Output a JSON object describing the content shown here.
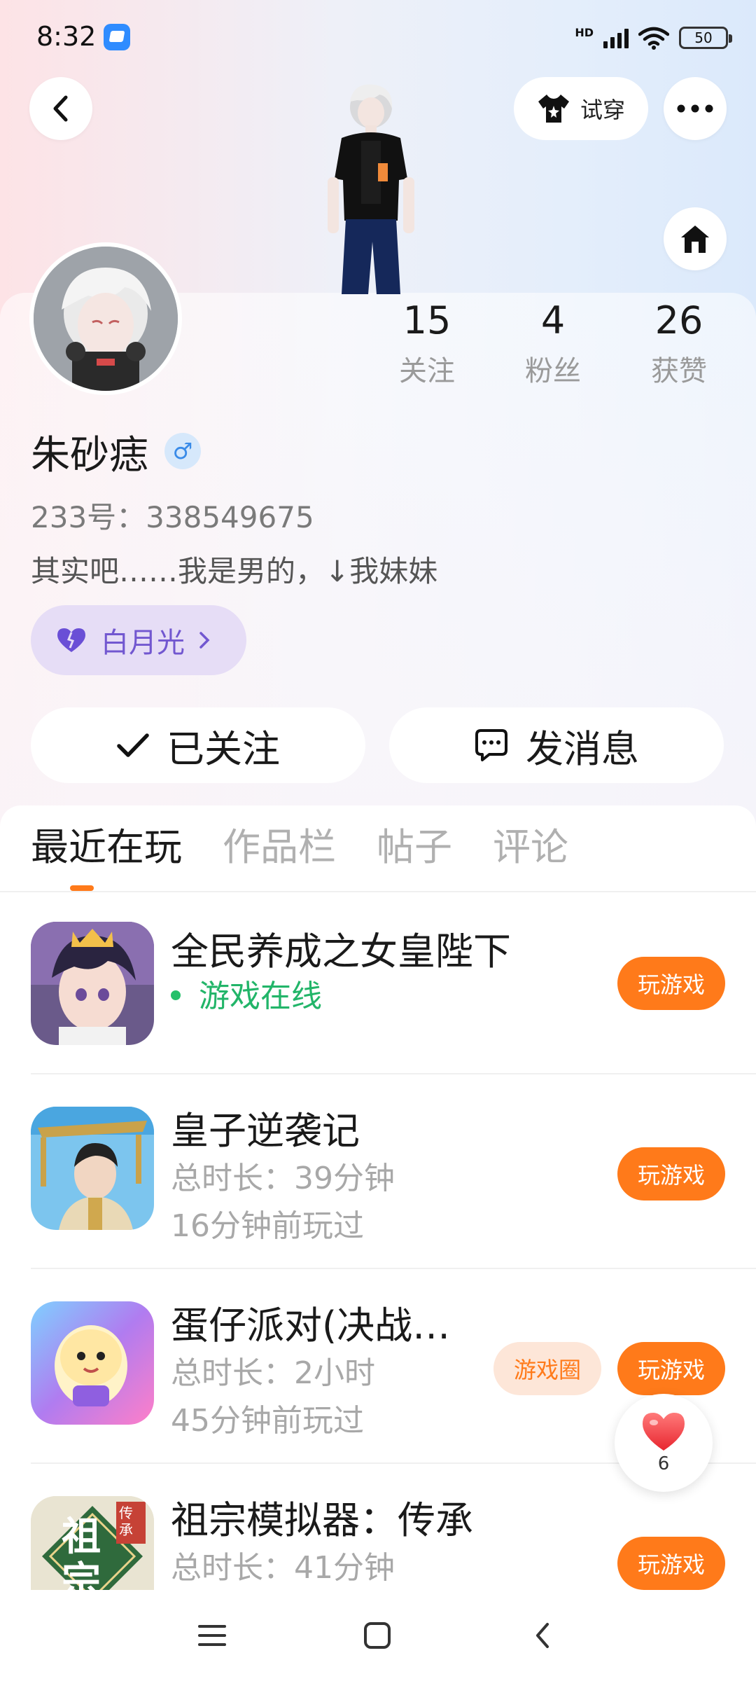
{
  "status_bar": {
    "time": "8:32",
    "hd": "HD",
    "battery": "50"
  },
  "header": {
    "tryon_label": "试穿"
  },
  "profile": {
    "name": "朱砂痣",
    "gender_symbol": "♂",
    "user_id": "233号：338549675",
    "bio": "其实吧……我是男的，↓我妹妹",
    "tag": "白月光",
    "stats": [
      {
        "value": "15",
        "label": "关注"
      },
      {
        "value": "4",
        "label": "粉丝"
      },
      {
        "value": "26",
        "label": "获赞"
      }
    ]
  },
  "actions": {
    "follow_label": "已关注",
    "message_label": "发消息"
  },
  "tabs": [
    "最近在玩",
    "作品栏",
    "帖子",
    "评论"
  ],
  "games": [
    {
      "title": "全民养成之女皇陛下",
      "status": "游戏在线",
      "play_label": "玩游戏"
    },
    {
      "title": "皇子逆袭记",
      "duration": "总时长：39分钟",
      "last_played": "16分钟前玩过",
      "play_label": "玩游戏"
    },
    {
      "title": "蛋仔派对(决战…",
      "duration": "总时长：2小时",
      "last_played": "45分钟前玩过",
      "circle_label": "游戏圈",
      "play_label": "玩游戏"
    },
    {
      "title": "祖宗模拟器：传承",
      "duration": "总时长：41分钟",
      "play_label": "玩游戏",
      "icon_text": "祖宗",
      "icon_tag": "传承"
    }
  ],
  "like_float": {
    "count": "6"
  },
  "colors": {
    "accent": "#ff7a1a",
    "online": "#22b569",
    "tag_bg": "#e6ddf6",
    "tag_text": "#7257d0"
  }
}
